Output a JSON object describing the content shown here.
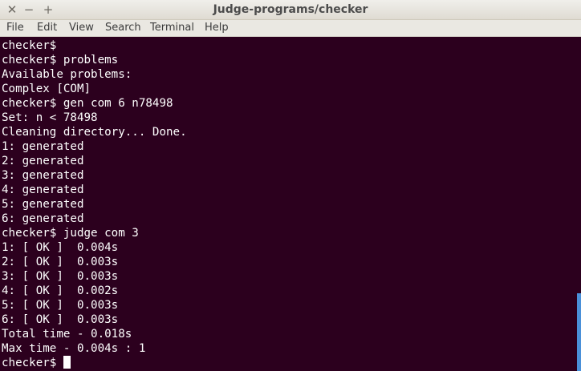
{
  "window": {
    "title": "Judge-programs/checker",
    "close_glyph": "✕",
    "minimize_glyph": "−",
    "maximize_glyph": "+"
  },
  "menu": [
    "File",
    "Edit",
    "View",
    "Search",
    "Terminal",
    "Help"
  ],
  "terminal": {
    "lines": [
      "checker$",
      "checker$ problems",
      "Available problems:",
      "Complex [COM]",
      "checker$ gen com 6 n78498",
      "Set: n < 78498",
      "Cleaning directory... Done.",
      "1: generated",
      "2: generated",
      "3: generated",
      "4: generated",
      "5: generated",
      "6: generated",
      "checker$ judge com 3",
      "1: [ OK ]  0.004s",
      "2: [ OK ]  0.003s",
      "3: [ OK ]  0.003s",
      "4: [ OK ]  0.002s",
      "5: [ OK ]  0.003s",
      "6: [ OK ]  0.003s",
      "Total time - 0.018s",
      "Max time - 0.004s : 1",
      "checker$ "
    ]
  },
  "colors": {
    "background": "#2c001e",
    "text": "#ffffff",
    "scrollbar_thumb": "#4a90d9"
  }
}
